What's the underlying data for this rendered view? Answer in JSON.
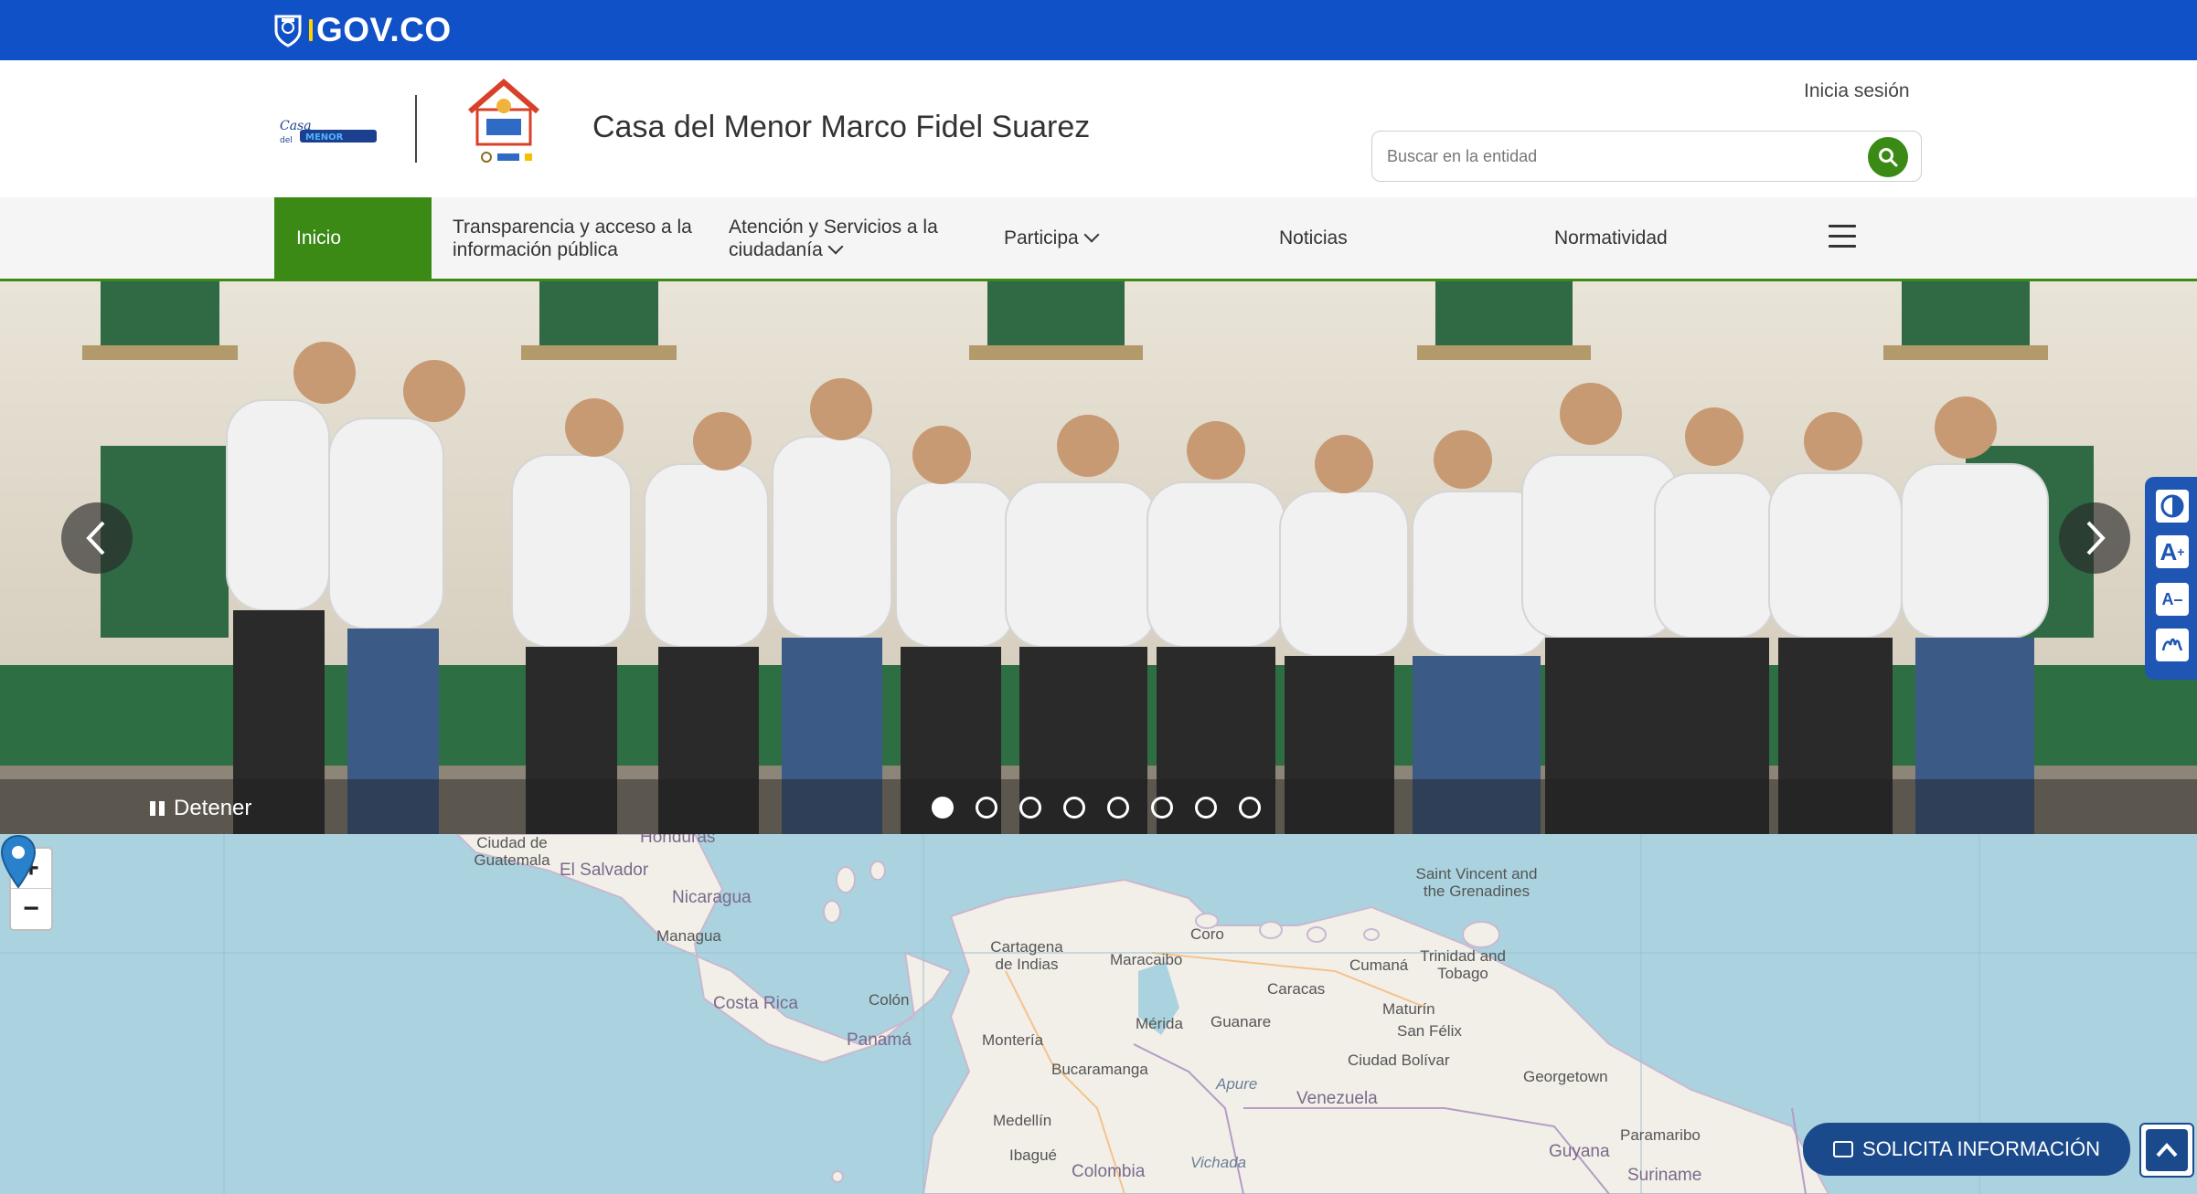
{
  "govbar": {
    "brand": "GOV.CO"
  },
  "header": {
    "entity_name": "Casa del Menor Marco Fidel Suarez",
    "login": "Inicia sesión",
    "search_placeholder": "Buscar en la entidad"
  },
  "nav": {
    "items": [
      {
        "label": "Inicio"
      },
      {
        "label": "Transparencia y acceso a la información pública"
      },
      {
        "label": "Atención y Servicios a la ciudadanía"
      },
      {
        "label": "Participa"
      },
      {
        "label": "Noticias"
      },
      {
        "label": "Normatividad"
      }
    ]
  },
  "hero": {
    "pause_label": "Detener",
    "slides_total": 8,
    "active_slide": 1
  },
  "map": {
    "labels": {
      "guatemala": "Ciudad de Guatemala",
      "honduras": "Honduras",
      "el_salvador": "El Salvador",
      "nicaragua": "Nicaragua",
      "managua": "Managua",
      "costa_rica": "Costa Rica",
      "colon": "Colón",
      "panama": "Panamá",
      "cartagena": "Cartagena de Indias",
      "maracaibo": "Maracaibo",
      "coro": "Coro",
      "caracas": "Caracas",
      "cumana": "Cumaná",
      "maturin": "Maturín",
      "san_felix": "San Félix",
      "ciudad_bolivar": "Ciudad Bolívar",
      "merida": "Mérida",
      "guanare": "Guanare",
      "monteria": "Montería",
      "bucaramanga": "Bucaramanga",
      "apure": "Apure",
      "venezuela": "Venezuela",
      "medellin": "Medellín",
      "ibague": "Ibagué",
      "colombia": "Colombia",
      "vichada": "Vichada",
      "saint_vincent": "Saint Vincent and the Grenadines",
      "trinidad": "Trinidad and Tobago",
      "georgetown": "Georgetown",
      "guyana": "Guyana",
      "paramaribo": "Paramaribo",
      "suriname": "Suriname"
    }
  },
  "widgets": {
    "solicita": "SOLICITA INFORMACIÓN"
  },
  "colors": {
    "gov_blue": "#1151c7",
    "nav_green": "#3b8a16",
    "a11y_blue": "#1f56b3",
    "cta_blue": "#1a4a8c"
  }
}
